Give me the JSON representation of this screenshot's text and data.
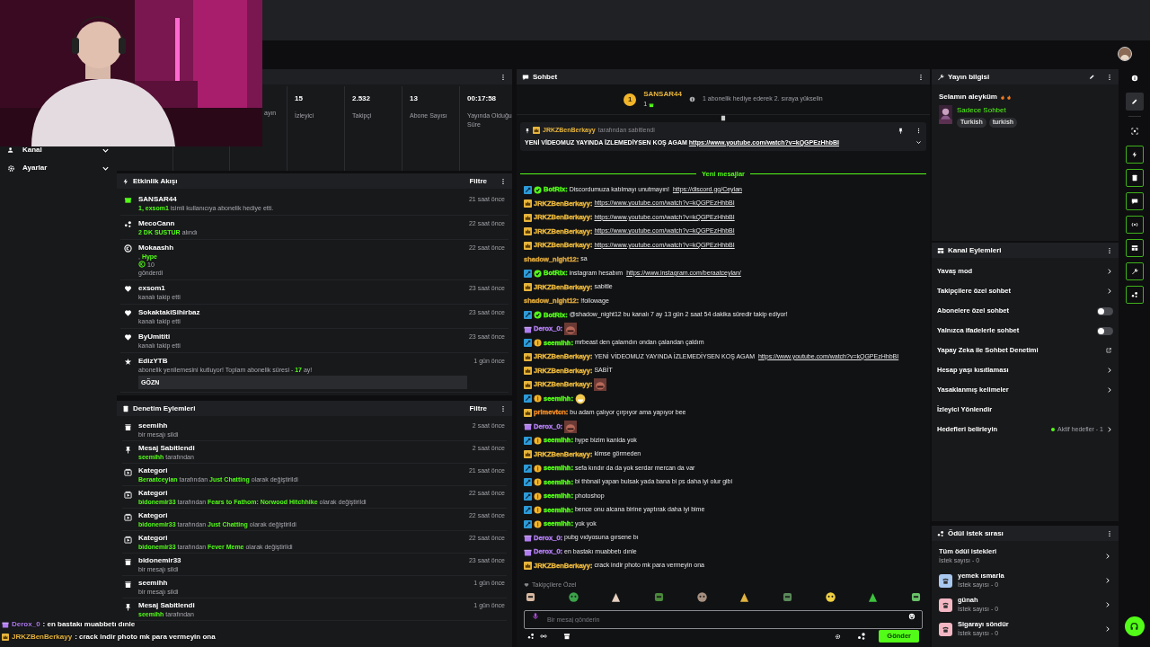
{
  "sidebar": {
    "items": [
      {
        "label": "Kanal"
      },
      {
        "label": "Ayarlar"
      }
    ]
  },
  "stats": [
    {
      "label": "ayın"
    },
    {
      "value": "15",
      "label": "İzleyici"
    },
    {
      "value": "2.532",
      "label": "Takipçi"
    },
    {
      "value": "13",
      "label": "Abone Sayısı"
    },
    {
      "value": "00:17:58",
      "label": "Yayında Olduğu Süre"
    }
  ],
  "activity": {
    "title": "Etkinlik Akışı",
    "filter": "Filtre",
    "items": [
      {
        "kind": "giftsub",
        "user": "SANSAR44",
        "lines": [
          [
            {
              "text": "1, exsom1",
              "hl": true
            },
            {
              "text": " isimli kullanıcıya abonelik hediye etti."
            }
          ]
        ],
        "time": "21 saat önce"
      },
      {
        "kind": "reward",
        "user": "MecoCann",
        "lines": [
          [
            {
              "text": "2 DK SUSTUR",
              "hl": true
            },
            {
              "text": " alındı"
            }
          ]
        ],
        "time": "22 saat önce"
      },
      {
        "kind": "hype",
        "user": "Mokaashh",
        "lines": [
          [
            {
              "text": ", "
            },
            {
              "text": "Hype",
              "hl": true
            }
          ],
          [
            {
              "text": "10",
              "coin": true
            }
          ],
          [
            {
              "text": "gönderdi"
            }
          ]
        ],
        "time": "22 saat önce"
      },
      {
        "kind": "follow",
        "user": "exsom1",
        "lines": [
          [
            {
              "text": "kanalı takip etti"
            }
          ]
        ],
        "time": "23 saat önce"
      },
      {
        "kind": "follow",
        "user": "SokaktakiSihirbaz",
        "lines": [
          [
            {
              "text": "kanalı takip etti"
            }
          ]
        ],
        "time": "23 saat önce"
      },
      {
        "kind": "follow",
        "user": "ByUmititi",
        "lines": [
          [
            {
              "text": "kanalı takip etti"
            }
          ]
        ],
        "time": "23 saat önce"
      },
      {
        "kind": "resub",
        "user": "EdizYTB",
        "lines": [
          [
            {
              "text": "abonelik yenilemesini kutluyor! Toplam abonelik süresi - "
            },
            {
              "text": "17",
              "hl": true
            },
            {
              "text": " ay!"
            }
          ]
        ],
        "message": "GÖZN",
        "time": "1 gün önce"
      }
    ]
  },
  "moderation": {
    "title": "Denetim Eylemleri",
    "filter": "Filtre",
    "items": [
      {
        "kind": "delete",
        "title": "seemihh",
        "parts": [
          {
            "text": "bir mesajı sildi"
          }
        ],
        "time": "2 saat önce"
      },
      {
        "kind": "pin",
        "title": "Mesaj Sabitlendi",
        "parts": [
          {
            "text": "seemihh",
            "hl": true
          },
          {
            "text": " tarafından"
          }
        ],
        "time": "2 saat önce"
      },
      {
        "kind": "category",
        "title": "Kategori",
        "parts": [
          {
            "text": "Beraatceylan",
            "hl": true
          },
          {
            "text": " tarafından "
          },
          {
            "text": "Just Chatting",
            "hl": true
          },
          {
            "text": " olarak değiştirildi"
          }
        ],
        "time": "21 saat önce"
      },
      {
        "kind": "category",
        "title": "Kategori",
        "parts": [
          {
            "text": "bidonemir33",
            "hl": true
          },
          {
            "text": " tarafından "
          },
          {
            "text": "Fears to Fathom: Norwood Hitchhike",
            "hl": true
          },
          {
            "text": " olarak değiştirildi"
          }
        ],
        "time": "22 saat önce"
      },
      {
        "kind": "category",
        "title": "Kategori",
        "parts": [
          {
            "text": "bidonemir33",
            "hl": true
          },
          {
            "text": " tarafından "
          },
          {
            "text": "Just Chatting",
            "hl": true
          },
          {
            "text": " olarak değiştirildi"
          }
        ],
        "time": "22 saat önce"
      },
      {
        "kind": "category",
        "title": "Kategori",
        "parts": [
          {
            "text": "bidonemir33",
            "hl": true
          },
          {
            "text": " tarafından "
          },
          {
            "text": "Fever Meme",
            "hl": true
          },
          {
            "text": " olarak değiştirildi"
          }
        ],
        "time": "22 saat önce"
      },
      {
        "kind": "delete",
        "title": "bidonemir33",
        "parts": [
          {
            "text": "bir mesajı sildi"
          }
        ],
        "time": "23 saat önce"
      },
      {
        "kind": "delete",
        "title": "seemihh",
        "parts": [
          {
            "text": "bir mesajı sildi"
          }
        ],
        "time": "1 gün önce"
      },
      {
        "kind": "pin",
        "title": "Mesaj Sabitlendi",
        "parts": [
          {
            "text": "seemihh",
            "hl": true
          },
          {
            "text": " tarafından"
          }
        ],
        "time": "1 gün önce"
      }
    ]
  },
  "chat": {
    "title": "Sohbet",
    "leader": {
      "rank": "1",
      "user": "SANSAR44",
      "count": "1",
      "hint": "1 abonelik hediye ederek 2. sıraya yükselin"
    },
    "pinned": {
      "user": "JRKZBenBerkayy",
      "by": "tarafından sabitlendi",
      "text": "YENİ VİDEOMUZ YAYINDA İZLEMEDİYSEN KOŞ AGAM ",
      "link": "https://www.youtube.com/watch?v=kQGPEzHhbBI"
    },
    "divider": "Yeni mesajlar",
    "messages": [
      {
        "kind": "bot",
        "user": "BotRix:",
        "color": "#53fc18",
        "text": "Discordumuza katılmayı unutmayın! ",
        "link": "https://discord.gg/Ceylan"
      },
      {
        "kind": "vip",
        "user": "JRKZBenBerkayy:",
        "color": "#e7b53c",
        "link": "https://www.youtube.com/watch?v=kQGPEzHhbBI"
      },
      {
        "kind": "vip",
        "user": "JRKZBenBerkayy:",
        "color": "#e7b53c",
        "link": "https://www.youtube.com/watch?v=kQGPEzHhbBI"
      },
      {
        "kind": "vip",
        "user": "JRKZBenBerkayy:",
        "color": "#e7b53c",
        "link": "https://www.youtube.com/watch?v=kQGPEzHhbBI"
      },
      {
        "kind": "vip",
        "user": "JRKZBenBerkayy:",
        "color": "#e7b53c",
        "link": "https://www.youtube.com/watch?v=kQGPEzHhbBI"
      },
      {
        "kind": "plain",
        "user": "shadow_night12:",
        "color": "#d9a43a",
        "text": "sa"
      },
      {
        "kind": "bot",
        "user": "BotRix:",
        "color": "#53fc18",
        "text": "instagram hesabım ",
        "link": "https://www.instagram.com/beraatceylan/"
      },
      {
        "kind": "vip",
        "user": "JRKZBenBerkayy:",
        "color": "#e7b53c",
        "text": "sabitle"
      },
      {
        "kind": "plain",
        "user": "shadow_night12:",
        "color": "#d9a43a",
        "text": "!followage"
      },
      {
        "kind": "bot",
        "user": "BotRix:",
        "color": "#53fc18",
        "text": "@shadow_night12 bu kanalı 7 ay 13 gün 2 saat 54 dakika süredir takip ediyor!"
      },
      {
        "kind": "gifter",
        "user": "Derox_0:",
        "color": "#b07cf0",
        "emote": {
          "kind": "face"
        }
      },
      {
        "kind": "modsub",
        "user": "seemihh:",
        "color": "#53fc18",
        "text": "mrbeast den çalamdın ondan çalandan çaldım"
      },
      {
        "kind": "vip",
        "user": "JRKZBenBerkayy:",
        "color": "#e7b53c",
        "text": "YENİ VİDEOMUZ YAYINDA İZLEMEDİYSEN KOŞ AGAM ",
        "link": "https://www.youtube.com/watch?v=kQGPEzHhbBI"
      },
      {
        "kind": "vip",
        "user": "JRKZBenBerkayy:",
        "color": "#e7b53c",
        "text": "SABİT"
      },
      {
        "kind": "vip",
        "user": "JRKZBenBerkayy:",
        "color": "#e7b53c",
        "emote": {
          "kind": "face"
        }
      },
      {
        "kind": "modsub",
        "user": "seemihh:",
        "color": "#53fc18",
        "emote": {
          "kind": "smiley"
        }
      },
      {
        "kind": "vip",
        "user": "primevtcn:",
        "color": "#f08a24",
        "text": "bu adam çalıyor çırpıyor ama yapıyor bee"
      },
      {
        "kind": "gifter",
        "user": "Derox_0:",
        "color": "#b07cf0",
        "emote": {
          "kind": "face"
        }
      },
      {
        "kind": "modsub",
        "user": "seemihh:",
        "color": "#53fc18",
        "text": "hype bizim kanlda yok"
      },
      {
        "kind": "vip",
        "user": "JRKZBenBerkayy:",
        "color": "#e7b53c",
        "text": "kimse görmeden"
      },
      {
        "kind": "modsub",
        "user": "seemihh:",
        "color": "#53fc18",
        "text": "sefa kındır da da yok serdar mercan da var"
      },
      {
        "kind": "modsub",
        "user": "seemihh:",
        "color": "#53fc18",
        "text": "bi thbnail yapan bulsak yada bana bi ps daha iyi olur gibi"
      },
      {
        "kind": "modsub",
        "user": "seemihh:",
        "color": "#53fc18",
        "text": "photoshop"
      },
      {
        "kind": "modsub",
        "user": "seemihh:",
        "color": "#53fc18",
        "text": "bence onu alcana birine yaptırak daha iyi bime"
      },
      {
        "kind": "modsub",
        "user": "seemihh:",
        "color": "#53fc18",
        "text": "yok yok"
      },
      {
        "kind": "gifter",
        "user": "Derox_0:",
        "color": "#b07cf0",
        "text": "pubg vıdyosuna gırsene bı"
      },
      {
        "kind": "gifter",
        "user": "Derox_0:",
        "color": "#b07cf0",
        "text": "en bastakı muabbetı dınle"
      },
      {
        "kind": "vip",
        "user": "JRKZBenBerkayy:",
        "color": "#e7b53c",
        "text": "crack indir photo mk para vermeyin ona"
      }
    ],
    "emote_section": "Takipçilere Özel",
    "placeholder": "Bir mesaj gönderin",
    "send": "Gönder"
  },
  "stream_info": {
    "title": "Yayın bilgisi",
    "stream_title": "Selamın aleyküm",
    "category": "Sadece Sohbet",
    "tags": [
      "Turkish",
      "turkish"
    ]
  },
  "channel_actions": {
    "title": "Kanal Eylemleri",
    "items": [
      {
        "label": "Yavaş mod",
        "kind": "arrow"
      },
      {
        "label": "Takipçilere özel sohbet",
        "kind": "arrow"
      },
      {
        "label": "Abonelere özel sohbet",
        "kind": "toggle",
        "on": false
      },
      {
        "label": "Yalnızca ifadelerle sohbet",
        "kind": "toggle",
        "on": false
      },
      {
        "label": "Yapay Zeka ile Sohbet Denetimi",
        "kind": "external"
      },
      {
        "label": "Hesap yaşı kısıtlaması",
        "kind": "arrow"
      },
      {
        "label": "Yasaklanmış kelimeler",
        "kind": "arrow"
      },
      {
        "label": "İzleyici Yönlendir",
        "kind": "plain"
      },
      {
        "label": "Hedefleri belirleyin",
        "kind": "arrow",
        "status": "Aktif hedefler - 1"
      }
    ]
  },
  "rewards": {
    "title": "Ödül istek sırası",
    "items": [
      {
        "label": "Tüm ödül istekleri",
        "count": "İstek sayısı - 0"
      },
      {
        "label": "yemek ısmarla",
        "count": "İstek sayısı - 0",
        "color": "#a9c8ef"
      },
      {
        "label": "günah",
        "count": "İstek sayısı - 0",
        "color": "#f3b7c3"
      },
      {
        "label": "Sigarayı söndür",
        "count": "İstek sayısı - 0",
        "color": "#f3b7c3"
      }
    ]
  },
  "rail": [
    {
      "kind": "plain",
      "selected": false
    },
    {
      "kind": "plain",
      "selected": true
    },
    {
      "kind": "plain",
      "selected": false
    },
    {
      "kind": "panel",
      "selected": false
    },
    {
      "kind": "panel",
      "selected": false
    },
    {
      "kind": "panel",
      "selected": false
    },
    {
      "kind": "panel",
      "selected": false
    },
    {
      "kind": "panel",
      "selected": false
    },
    {
      "kind": "panel",
      "selected": false
    },
    {
      "kind": "panel",
      "selected": false
    }
  ],
  "stream_overlay": [
    {
      "kind": "gifter",
      "user": "Derox_0",
      "color": "#b07cf0",
      "text": ": en bastakı muabbetı dınle"
    },
    {
      "kind": "vip",
      "user": "JRKZBenBerkayy",
      "color": "#e7b53c",
      "text": ": crack indir photo mk para vermeyin ona"
    }
  ]
}
